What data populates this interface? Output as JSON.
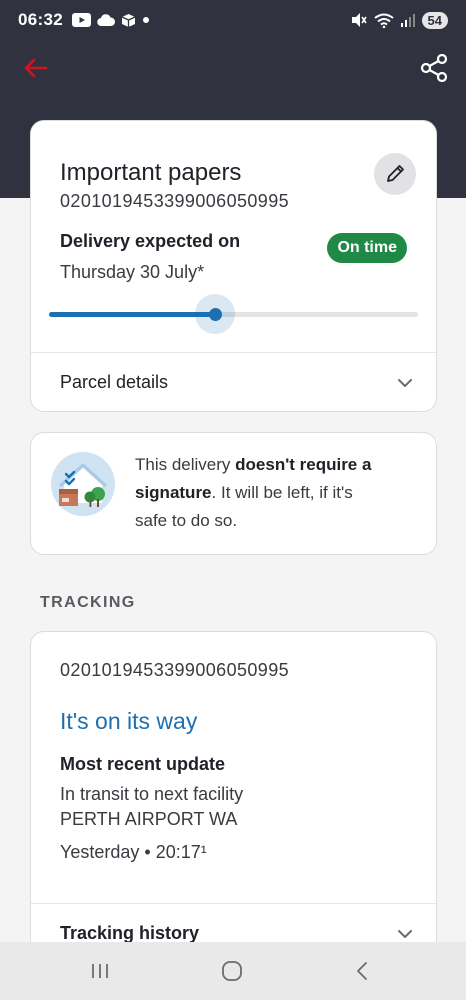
{
  "status_bar": {
    "time": "06:32",
    "battery": "54",
    "left_icons": [
      "youtube-icon",
      "cloud-icon",
      "package-icon",
      "dot-icon"
    ],
    "right_icons": [
      "mute-icon",
      "wifi-icon",
      "signal-icon"
    ]
  },
  "header": {
    "back_icon": "arrow-left-icon",
    "share_icon": "share-icon",
    "accent_color": "#d8121b"
  },
  "item": {
    "title": "Important papers",
    "tracking_id": "02010194533990060509​95",
    "expected_label": "Delivery expected on",
    "expected_date": "Thursday 30 July*",
    "status_badge": "On time",
    "progress_fraction": 0.45,
    "parcel_details_label": "Parcel details"
  },
  "signature_notice": {
    "text_before": "This delivery ",
    "text_bold_1": "doesn't require a",
    "text_bold_2": "signature",
    "text_after_1": ". It will be left, if it's",
    "text_after_2": "safe to do so."
  },
  "tracking": {
    "section_heading": "TRACKING",
    "tracking_id": "02010194533990060509​95",
    "status": "It's on its way",
    "recent_label": "Most recent update",
    "recent_line_1": "In transit to next facility",
    "recent_line_2": "PERTH AIRPORT WA",
    "recent_time": "Yesterday • 20:17¹",
    "history_label": "Tracking history"
  },
  "nav_bar": {
    "icons": [
      "recent-apps-icon",
      "home-icon",
      "back-icon"
    ]
  }
}
